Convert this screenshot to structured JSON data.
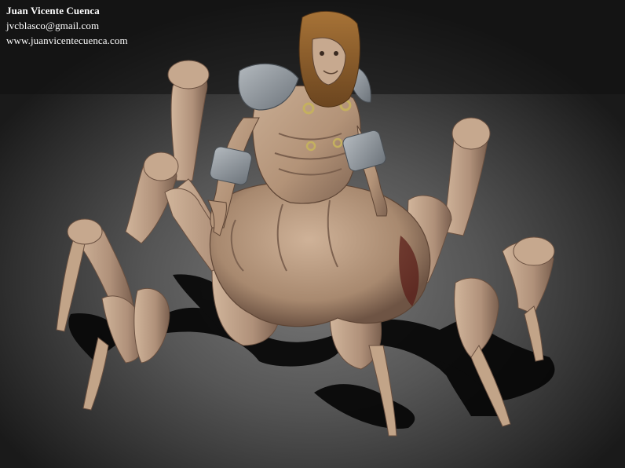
{
  "credits": {
    "name": "Juan Vicente Cuenca",
    "email": "jvcblasco@gmail.com",
    "website": "www.juanvicentecuenca.com"
  },
  "colors": {
    "skin": "#b79a80",
    "skin_shadow": "#7d6250",
    "hair": "#8a5a2a",
    "armor": "#8e959c",
    "gold": "#b8a45a",
    "shadow": "#050505"
  }
}
